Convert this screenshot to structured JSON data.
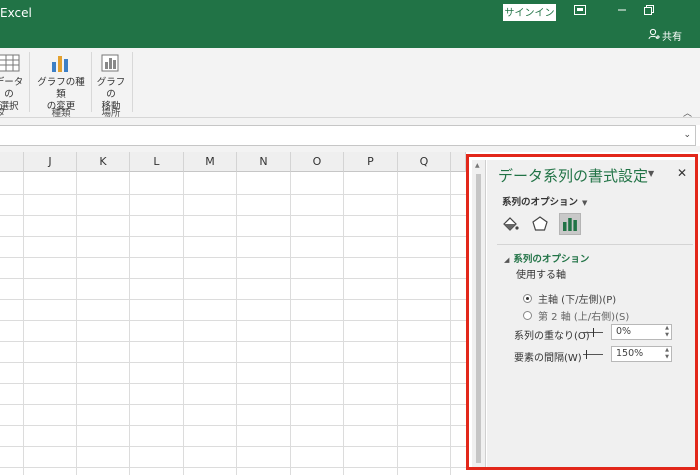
{
  "titlebar": {
    "app_title": "Excel",
    "signin_label": "サインイン",
    "share_label": "共有"
  },
  "ribbon": {
    "select_data_label_line1": "データの",
    "select_data_label_line2": "選択",
    "change_type_label_line1": "グラフの種類",
    "change_type_label_line2": "の変更",
    "move_chart_label_line1": "グラフの",
    "move_chart_label_line2": "移動",
    "group_data_suffix": "ダ",
    "group_type": "種類",
    "group_location": "場所"
  },
  "columns": [
    "J",
    "K",
    "L",
    "M",
    "N",
    "O",
    "P",
    "Q"
  ],
  "pane": {
    "title": "データ系列の書式設定",
    "options_dropdown": "系列のオプション",
    "section_title": "系列のオプション",
    "axis_label": "使用する軸",
    "primary_axis": "主軸 (下/左側)(P)",
    "secondary_axis": "第 2 軸 (上/右側)(S)",
    "overlap_label": "系列の重なり(O)",
    "overlap_value": "0%",
    "gap_label": "要素の間隔(W)",
    "gap_value": "150%"
  },
  "colors": {
    "accent": "#217346",
    "highlight_border": "#e2271a"
  },
  "icons": [
    "restore-icon",
    "maximize-icon",
    "user-icon",
    "fill-bucket-icon",
    "pentagon-icon",
    "bar-chart-icon",
    "close-icon"
  ]
}
